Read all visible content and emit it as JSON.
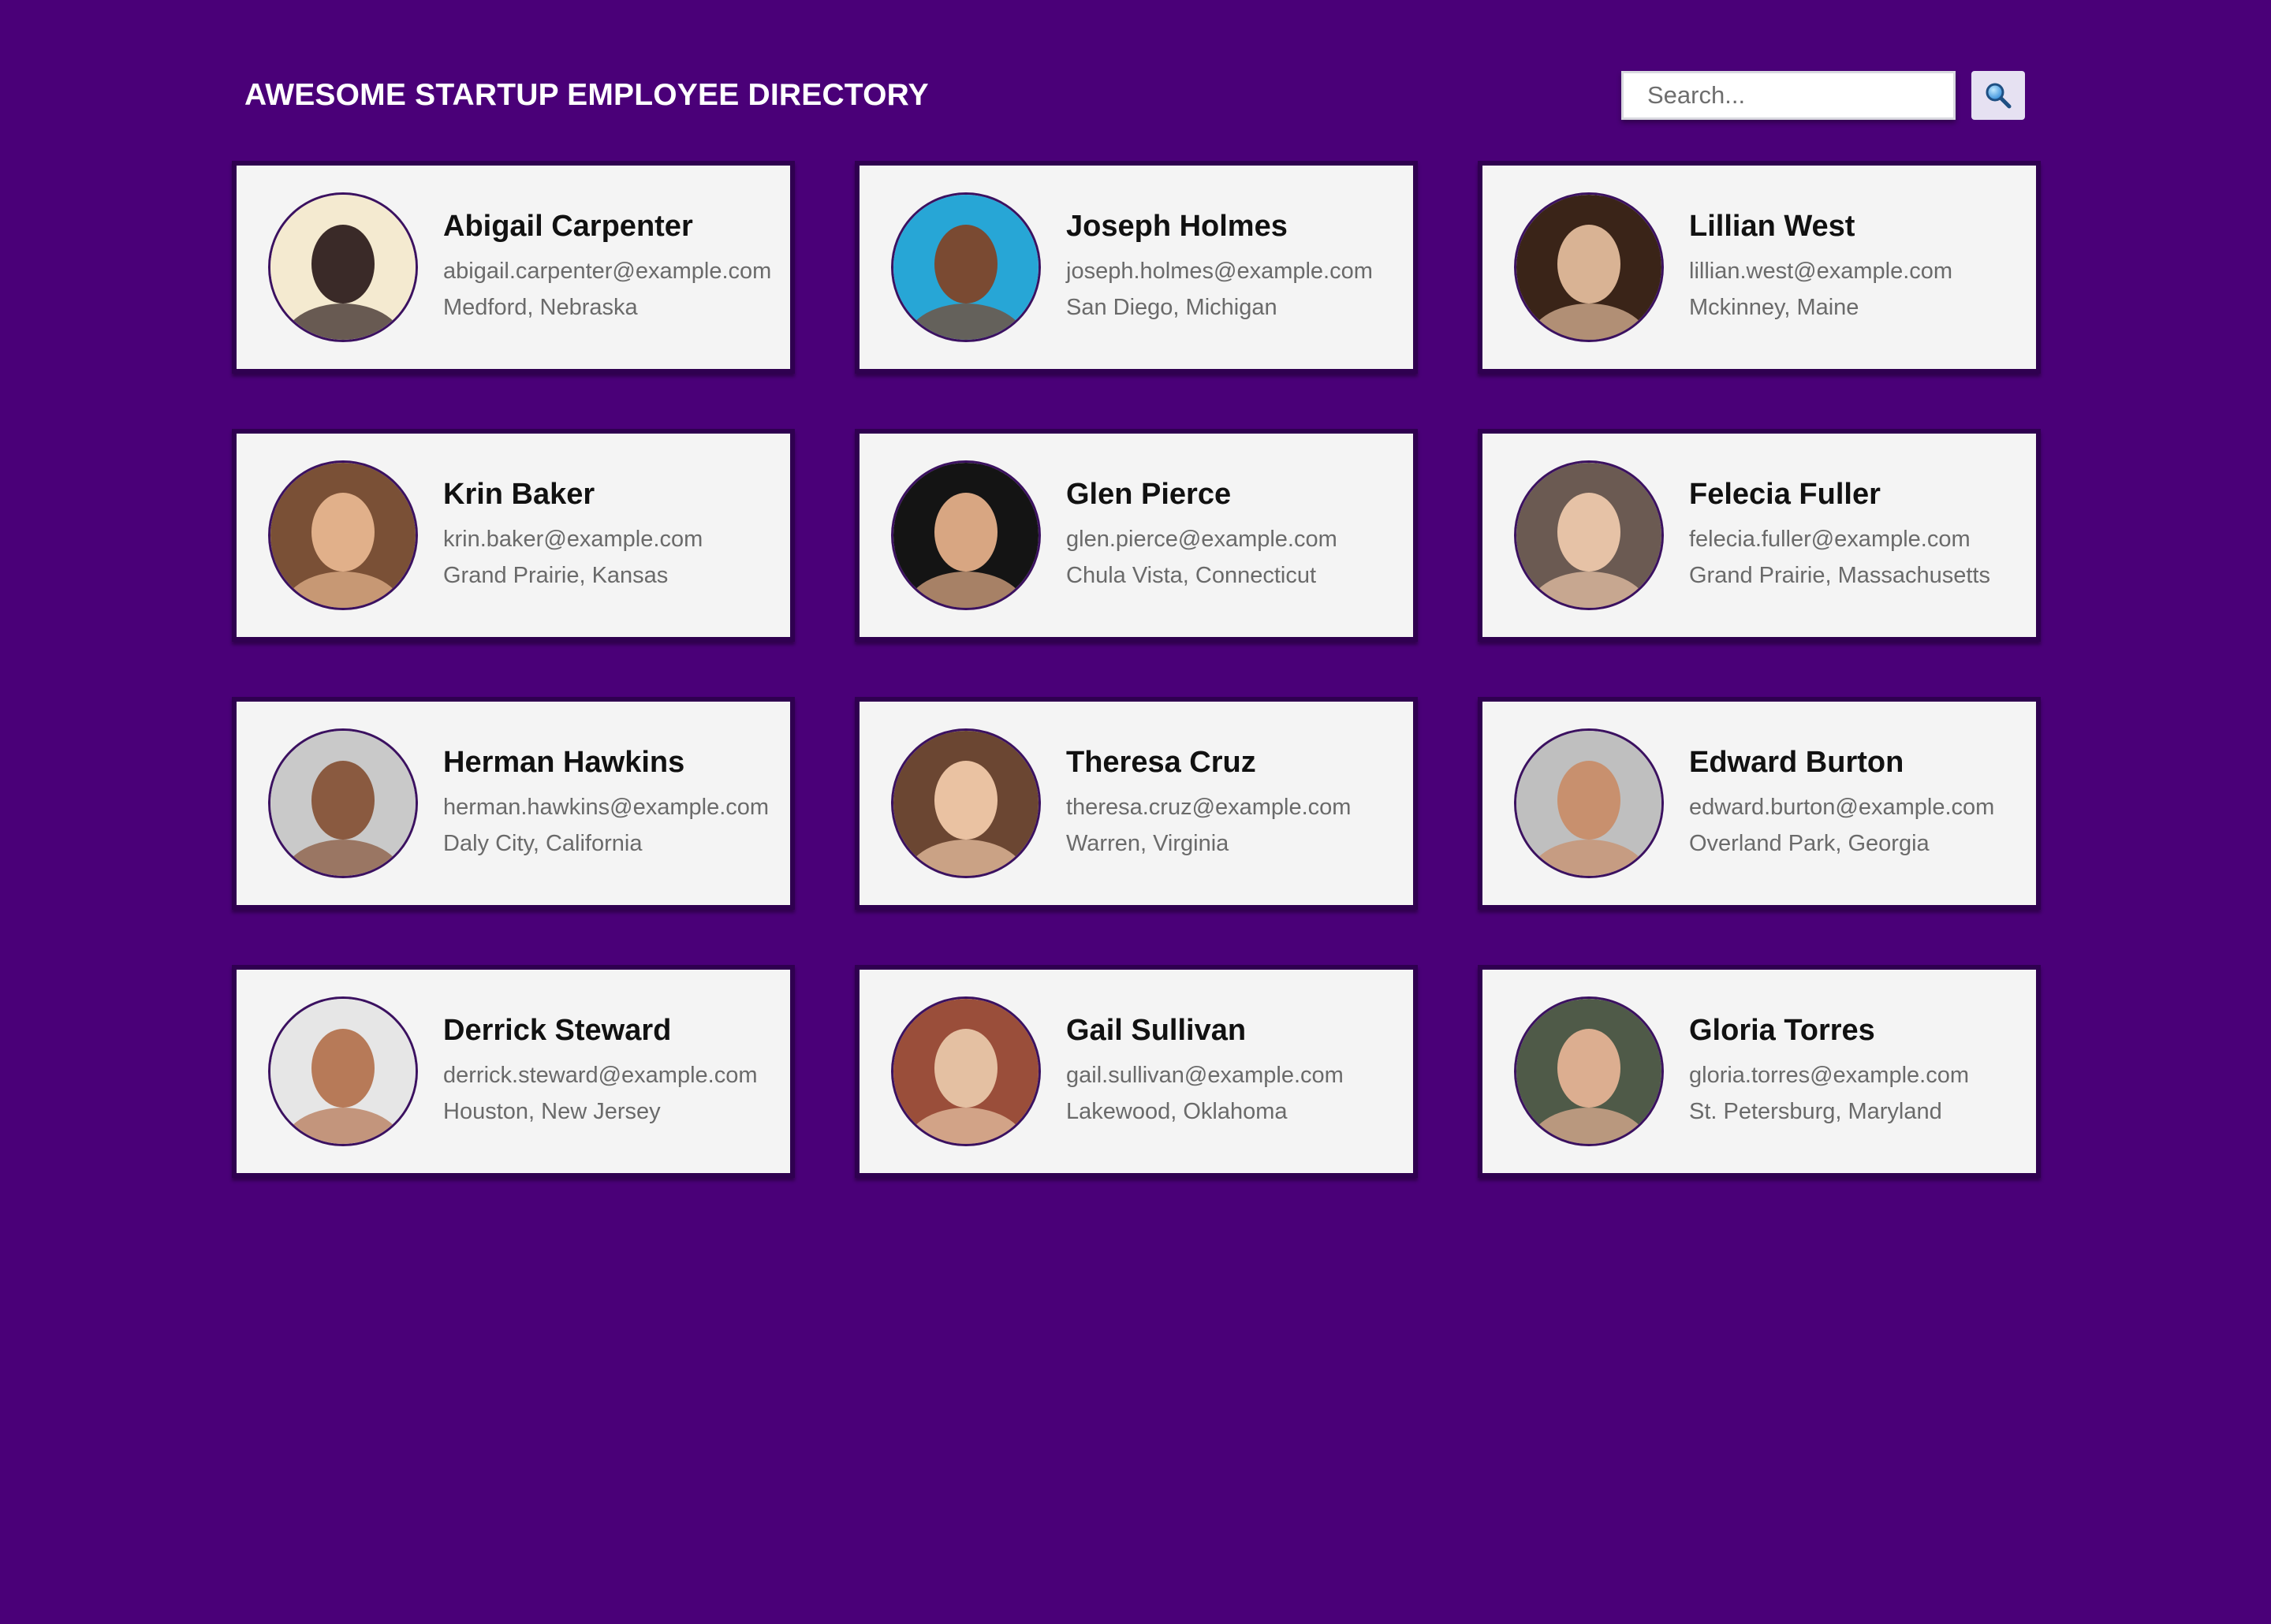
{
  "header": {
    "title": "AWESOME STARTUP EMPLOYEE DIRECTORY",
    "search_placeholder": "Search...",
    "search_value": "",
    "search_icon": "magnifier-icon"
  },
  "colors": {
    "background": "#4a0078",
    "card_background": "#f4f4f4",
    "card_border": "#2f0050"
  },
  "employees": [
    {
      "name": "Abigail Carpenter",
      "email": "abigail.carpenter@example.com",
      "location": "Medford, Nebraska",
      "avatar_colors": [
        "#f4ead0",
        "#3a2a28"
      ]
    },
    {
      "name": "Joseph Holmes",
      "email": "joseph.holmes@example.com",
      "location": "San Diego, Michigan",
      "avatar_colors": [
        "#27a6d6",
        "#7a4a32"
      ]
    },
    {
      "name": "Lillian West",
      "email": "lillian.west@example.com",
      "location": "Mckinney, Maine",
      "avatar_colors": [
        "#3a2418",
        "#d9b394"
      ]
    },
    {
      "name": "Krin Baker",
      "email": "krin.baker@example.com",
      "location": "Grand Prairie, Kansas",
      "avatar_colors": [
        "#7a5036",
        "#e1b08a"
      ]
    },
    {
      "name": "Glen Pierce",
      "email": "glen.pierce@example.com",
      "location": "Chula Vista, Connecticut",
      "avatar_colors": [
        "#141414",
        "#d8a682"
      ]
    },
    {
      "name": "Felecia Fuller",
      "email": "felecia.fuller@example.com",
      "location": "Grand Prairie, Massachusetts",
      "avatar_colors": [
        "#6b5a52",
        "#e6c2a6"
      ]
    },
    {
      "name": "Herman Hawkins",
      "email": "herman.hawkins@example.com",
      "location": "Daly City, California",
      "avatar_colors": [
        "#c9c9c9",
        "#8a5a40"
      ]
    },
    {
      "name": "Theresa Cruz",
      "email": "theresa.cruz@example.com",
      "location": "Warren, Virginia",
      "avatar_colors": [
        "#6b4632",
        "#eac2a2"
      ]
    },
    {
      "name": "Edward Burton",
      "email": "edward.burton@example.com",
      "location": "Overland Park, Georgia",
      "avatar_colors": [
        "#bfbfbf",
        "#c8906e"
      ]
    },
    {
      "name": "Derrick Steward",
      "email": "derrick.steward@example.com",
      "location": "Houston, New Jersey",
      "avatar_colors": [
        "#e6e6e6",
        "#b77a58"
      ]
    },
    {
      "name": "Gail Sullivan",
      "email": "gail.sullivan@example.com",
      "location": "Lakewood, Oklahoma",
      "avatar_colors": [
        "#9a4e3a",
        "#e4c0a2"
      ]
    },
    {
      "name": "Gloria Torres",
      "email": "gloria.torres@example.com",
      "location": "St. Petersburg, Maryland",
      "avatar_colors": [
        "#4f5a48",
        "#dcae90"
      ]
    }
  ]
}
